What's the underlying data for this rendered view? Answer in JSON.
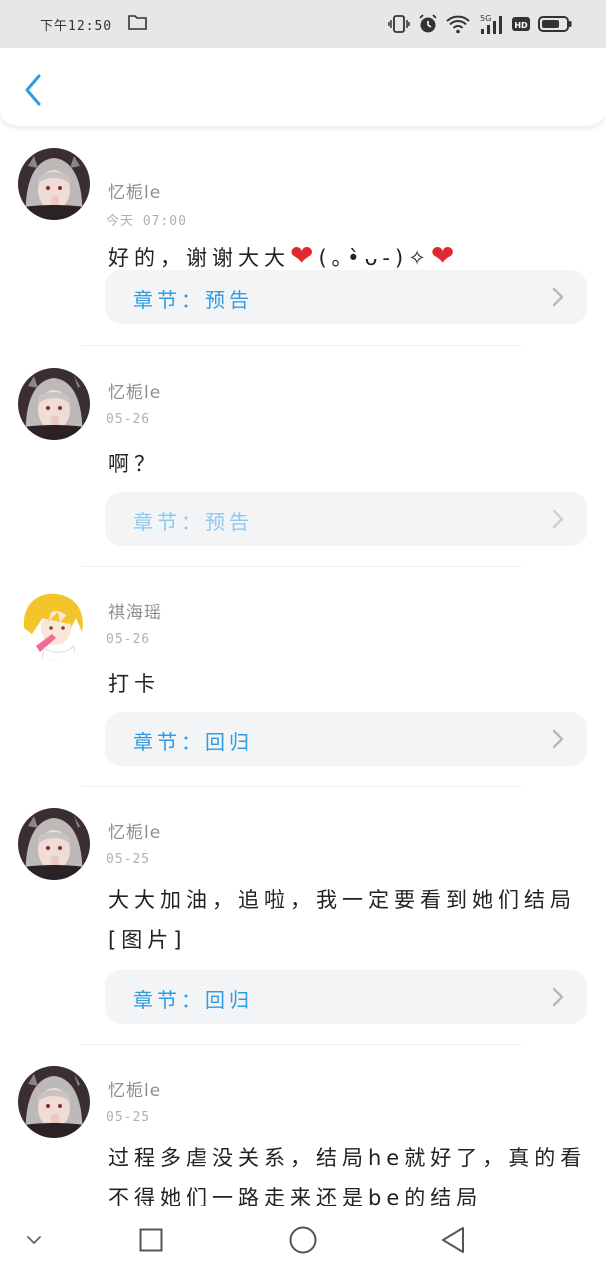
{
  "status_bar": {
    "time": "下午12:50",
    "network_label": "5G",
    "hd_label": "HD"
  },
  "header": {
    "back_icon": "chevron-left-icon"
  },
  "comments": [
    {
      "username": "忆栀le",
      "time": "今天 07:00",
      "text": "好的，谢谢大大❤️(｡•̀ᴗ-)✧❤️",
      "chapter": "章节：预告",
      "avatar": "gray-hair-girl"
    },
    {
      "username": "忆栀le",
      "time": "05-26",
      "text": "啊？",
      "chapter": "章节：预告",
      "avatar": "gray-hair-girl"
    },
    {
      "username": "祺海瑶",
      "time": "05-26",
      "text": "打卡",
      "chapter": "章节：回归",
      "avatar": "blonde-hair-girl"
    },
    {
      "username": "忆栀le",
      "time": "05-25",
      "text": "大大加油，追啦，我一定要看到她们结局[图片]",
      "chapter": "章节：回归",
      "avatar": "gray-hair-girl"
    },
    {
      "username": "忆栀le",
      "time": "05-25",
      "text": "过程多虐没关系，结局he就好了，真的看不得她们一路走来还是be的结局",
      "chapter": "",
      "avatar": "gray-hair-girl"
    }
  ],
  "bottom_nav": {
    "items": [
      "chevron-down-icon",
      "square-icon",
      "circle-icon",
      "triangle-back-icon"
    ]
  },
  "colors": {
    "accent": "#2f9be0",
    "card_bg": "#f3f4f6",
    "heart": "#e0292f"
  }
}
